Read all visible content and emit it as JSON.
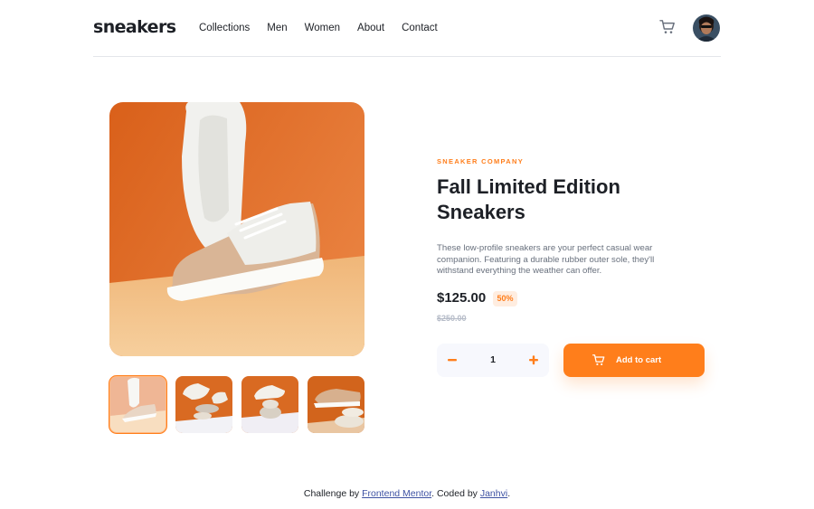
{
  "header": {
    "logo": "sneakers",
    "nav": [
      "Collections",
      "Men",
      "Women",
      "About",
      "Contact"
    ],
    "cart_icon": "cart-icon",
    "avatar_icon": "avatar"
  },
  "gallery": {
    "main_image": "sneaker-product-1",
    "thumbnails": [
      "thumbnail-1",
      "thumbnail-2",
      "thumbnail-3",
      "thumbnail-4"
    ],
    "active_thumbnail": 0
  },
  "product": {
    "company": "SNEAKER COMPANY",
    "title": "Fall Limited Edition Sneakers",
    "description": "These low-profile sneakers are your perfect casual wear companion. Featuring a durable rubber outer sole, they'll withstand everything the weather can offer.",
    "price": "$125.00",
    "discount": "50%",
    "old_price": "$250.00"
  },
  "cart": {
    "minus_icon": "minus-icon",
    "quantity": "1",
    "plus_icon": "plus-icon",
    "add_label": "Add to cart"
  },
  "footer": {
    "prefix": "Challenge by ",
    "link1": "Frontend Mentor",
    "middle": ". Coded by ",
    "link2": "Janhvi",
    "suffix": "."
  },
  "colors": {
    "accent": "#ff7e1b",
    "accent_pale": "#ffede0",
    "text_dark": "#1d2026",
    "text_grey": "#68707d",
    "text_light": "#b6bcc8"
  }
}
